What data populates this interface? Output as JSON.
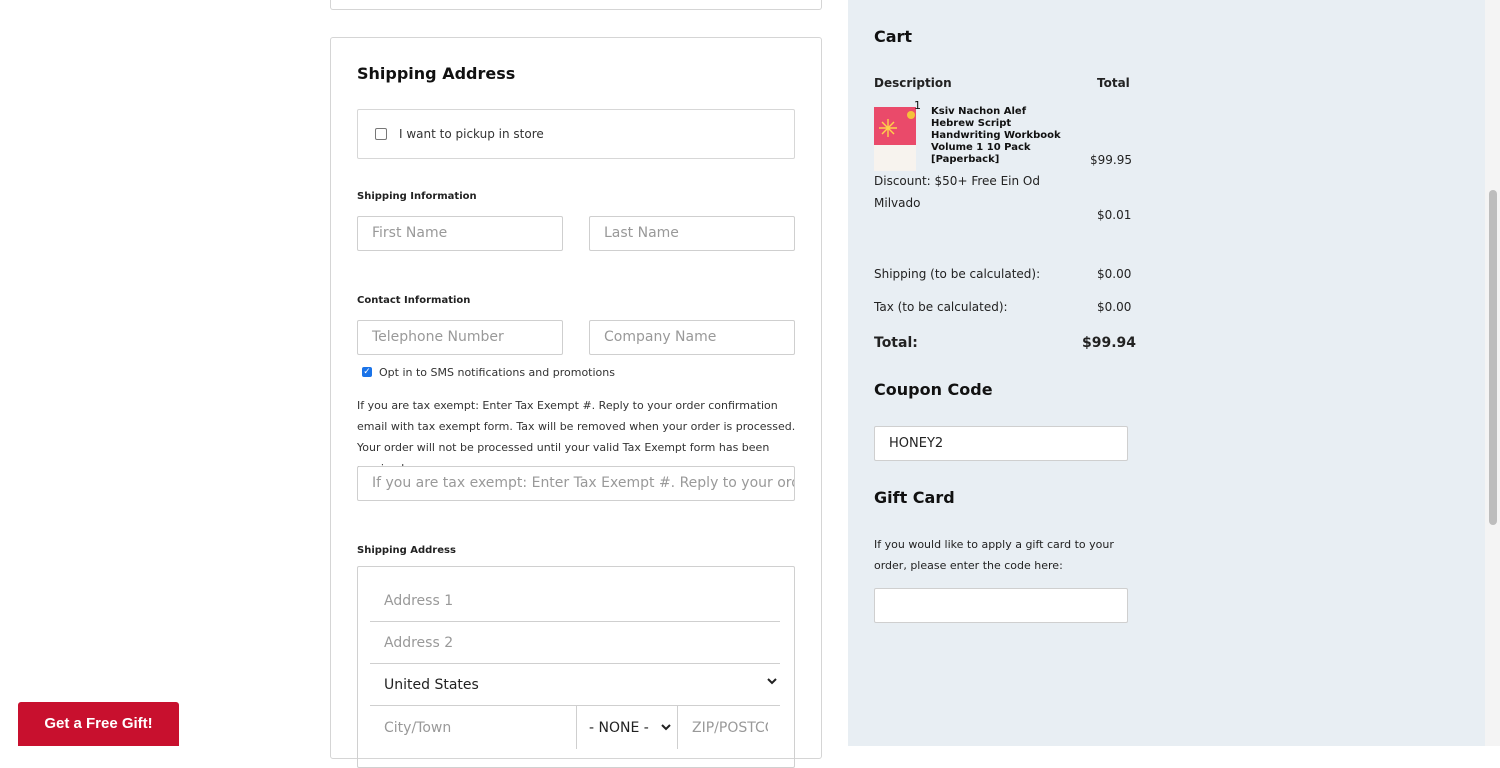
{
  "shipping": {
    "title": "Shipping Address",
    "pickup_label": "I want to pickup in store",
    "shipping_info_label": "Shipping Information",
    "first_name_placeholder": "First Name",
    "last_name_placeholder": "Last Name",
    "contact_info_label": "Contact Information",
    "telephone_placeholder": "Telephone Number",
    "company_placeholder": "Company Name",
    "sms_label": "Opt in to SMS notifications and promotions",
    "sms_checked": true,
    "tax_note": "If you are tax exempt: Enter Tax Exempt #. Reply to your order confirmation email with tax exempt form. Tax will be removed when your order is processed. Your order will not be processed until your valid Tax Exempt form has been received",
    "tax_placeholder": "If you are tax exempt: Enter Tax Exempt #. Reply to your order",
    "address_label": "Shipping Address",
    "address1_placeholder": "Address 1",
    "address2_placeholder": "Address 2",
    "country_value": "United States",
    "city_placeholder": "City/Town",
    "state_value": "- NONE -",
    "zip_placeholder": "ZIP/POSTCODE"
  },
  "cart": {
    "title": "Cart",
    "col_description": "Description",
    "col_total": "Total",
    "item": {
      "quantity": "1",
      "name_lines": [
        "Ksiv Nachon Alef",
        "Hebrew Script",
        "Handwriting Workbook",
        "Volume 1 10 Pack",
        "[Paperback]"
      ],
      "price": "$99.95"
    },
    "discount_line1": "Discount: $50+ Free Ein Od",
    "discount_line2": "Milvado",
    "discount_amount": "$0.01",
    "shipping_label": "Shipping (to be calculated):",
    "shipping_amount": "$0.00",
    "tax_label": "Tax (to be calculated):",
    "tax_amount": "$0.00",
    "total_label": "Total:",
    "total_amount": "$99.94"
  },
  "coupon": {
    "title": "Coupon Code",
    "value": "HONEY2"
  },
  "gift_card": {
    "title": "Gift Card",
    "note": "If you would like to apply a gift card to your order, please enter the code here:",
    "value": ""
  },
  "promo": {
    "gift_button": "Get a Free Gift!"
  },
  "colors": {
    "cart_bg": "#e8eef3",
    "gift_button": "#c8102e",
    "checkbox_accent": "#1a73e8"
  }
}
